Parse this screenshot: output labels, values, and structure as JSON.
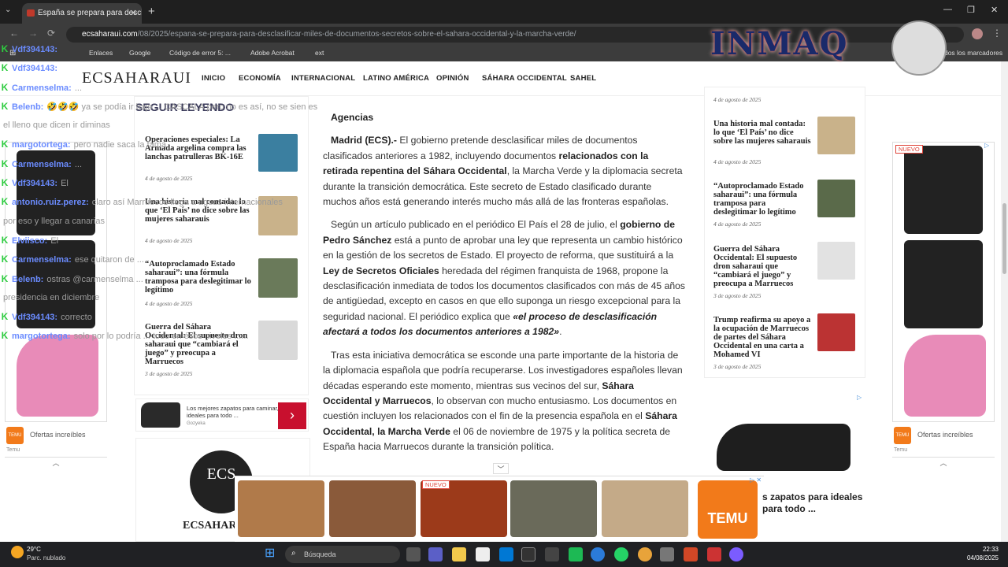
{
  "browser": {
    "tab_title": "España se prepara para desclasi",
    "url_host": "ecsaharaui.com",
    "url_path": "/08/2025/espana-se-prepara-para-desclasificar-miles-de-documentos-secretos-sobre-el-sahara-occidental-y-la-marcha-verde/",
    "bookmarks": [
      "Enlaces",
      "Google",
      "Código de error 5: ...",
      "Adobe Acrobat",
      "ext"
    ],
    "all_bookmarks": "Todos los marcadores"
  },
  "site": {
    "logo": "ECSAHARAUI",
    "nav": [
      "INICIO",
      "ECONOMÍA",
      "INTERNACIONAL",
      "LATINO AMÉRICA",
      "OPINIÓN",
      "SÁHARA OCCIDENTAL",
      "SAHEL"
    ],
    "left_heading": "SEGUIR LEYENDO",
    "left_cards": [
      {
        "title": "Operaciones especiales: La Armada argelina compra las lanchas patrulleras BK-16E",
        "date": "4 de agosto de 2025"
      },
      {
        "title": "Una historia mal contada: lo que ‘El País’ no dice sobre las mujeres saharauis",
        "date": "4 de agosto de 2025"
      },
      {
        "title": "“Autoproclamado Estado saharaui”: una fórmula tramposa para deslegitimar lo legítimo",
        "date": "4 de agosto de 2025"
      },
      {
        "title": "Guerra del Sáhara Occidental: El supuesto dron saharaui que “cambiará el juego” y preocupa a Marruecos",
        "date": "3 de agosto de 2025"
      }
    ],
    "left_ad": {
      "text": "Los mejores zapatos para caminar, ideales para todo ...",
      "source": "Gozyeka"
    },
    "bottom_logo": "ECSAHARAUI",
    "right_top_date": "4 de agosto de 2025",
    "right_cards": [
      {
        "title": "Una historia mal contada: lo que ‘El País’ no dice sobre las mujeres saharauis",
        "date": "4 de agosto de 2025"
      },
      {
        "title": "“Autoproclamado Estado saharaui”: una fórmula tramposa para deslegitimar lo legítimo",
        "date": "4 de agosto de 2025"
      },
      {
        "title": "Guerra del Sáhara Occidental: El supuesto dron saharaui que “cambiará el juego” y preocupa a Marruecos",
        "date": "3 de agosto de 2025"
      },
      {
        "title": "Trump reafirma su apoyo a la ocupación de Marruecos de partes del Sáhara Occidental en una carta a Mohamed VI",
        "date": "3 de agosto de 2025"
      }
    ]
  },
  "article": {
    "byline": "Agencias",
    "p1_lead": "Madrid (ECS).-",
    "p1_a": " El gobierno pretende desclasificar miles de documentos clasificados anteriores a 1982, incluyendo documentos ",
    "p1_b": "relacionados con la retirada repentina del Sáhara Occidental",
    "p1_c": ", la Marcha Verde y la diplomacia secreta durante la transición democrática. Este secreto de Estado clasificado durante muchos años está generando interés mucho más allá de las fronteras españolas.",
    "p2_a": "Según un artículo publicado en el periódico El País el 28 de julio, el ",
    "p2_b": "gobierno de Pedro Sánchez",
    "p2_c": " está a punto de aprobar una ley que representa un cambio histórico en la gestión de los secretos de Estado. El proyecto de reforma, que sustituirá a la ",
    "p2_d": "Ley de Secretos Oficiales",
    "p2_e": " heredada del régimen franquista de 1968, propone la desclasificación inmediata de todos los documentos clasificados con más de 45 años de antigüedad, excepto en casos en que ello suponga un riesgo excepcional para la seguridad nacional. El periódico explica que ",
    "p2_f": "«el proceso de desclasificación afectará a todos los documentos anteriores a 1982»",
    "p2_g": ".",
    "p3_a": "Tras esta iniciativa democrática se esconde una parte importante de la historia de la diplomacia española que podría recuperarse. Los investigadores españoles llevan décadas esperando este momento, mientras sus vecinos del sur, ",
    "p3_b": "Sáhara Occidental y Marruecos",
    "p3_c": ", lo observan con mucho entusiasmo. Los documentos en cuestión incluyen los relacionados con el fin de la presencia española en el ",
    "p3_d": "Sáhara Occidental, la Marcha Verde",
    "p3_e": " el 06 de noviembre de 1975 y la política secreta de España hacia Marruecos durante la transición política."
  },
  "chat": [
    {
      "user": "Vdf394143:",
      "msg": ""
    },
    {
      "user": "Vdf394143:",
      "msg": ""
    },
    {
      "user": "Carmenselma:",
      "msg": "..."
    },
    {
      "user": "Belenb:",
      "msg": "🤣🤣🤣 ya se podía ir bajo ... CASCALA pero no es así, no se sien es"
    },
    {
      "user": "",
      "msg": "el lleno que dicen ir diminas"
    },
    {
      "user": "margotortega:",
      "msg": "pero nadie saca la fama"
    },
    {
      "user": "Carmenselma:",
      "msg": "..."
    },
    {
      "user": "Vdf394143:",
      "msg": "El"
    },
    {
      "user": "antonio.ruiz.perez:",
      "msg": "claro así Marruecos llega a aguas internacionales"
    },
    {
      "user": "",
      "msg": "por eso y llegar a canarias"
    },
    {
      "user": "Elviisco:",
      "msg": "El"
    },
    {
      "user": "Carmenselma:",
      "msg": "ese quitaron de ..."
    },
    {
      "user": "Belenb:",
      "msg": "ostras @carmenselma ..."
    },
    {
      "user": "",
      "msg": "presidencia en diciembre"
    },
    {
      "user": "Vdf394143:",
      "msg": "correcto"
    },
    {
      "user": "margotortega:",
      "msg": "solo por lo podría ... todo en ésos niveles ......"
    }
  ],
  "ads": {
    "offers": "Ofertas increíbles",
    "brand": "Temu",
    "new_badge": "NUEVO",
    "temu_logo": "TEMU",
    "bottom_text": "s zapatos para ideales para todo ..."
  },
  "overlay_logo": "INMAQ",
  "taskbar": {
    "temp": "29°C",
    "weather": "Parc. nublado",
    "search": "Búsqueda",
    "time": "22:33",
    "date": "04/08/2025"
  }
}
